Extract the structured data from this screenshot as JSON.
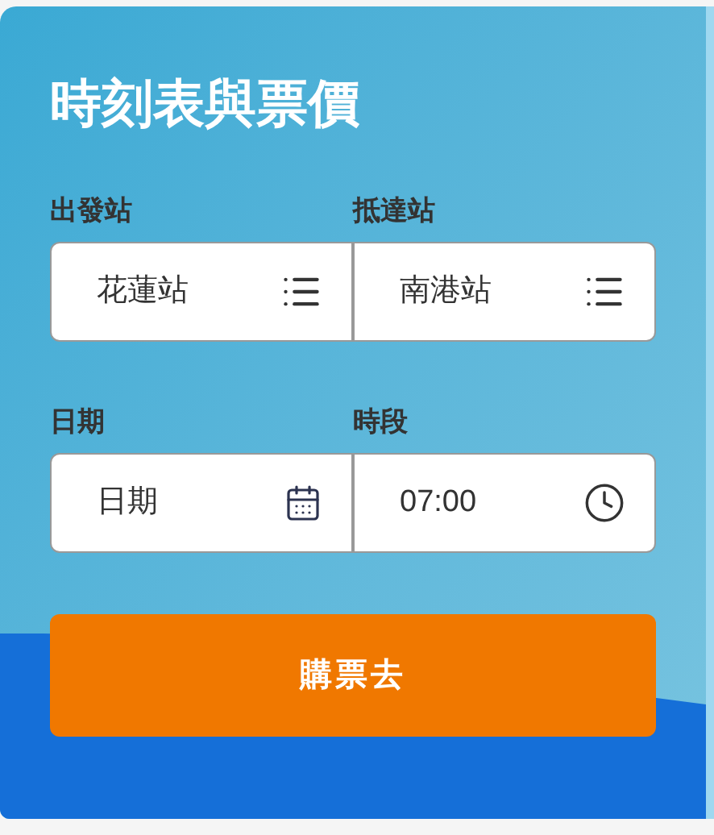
{
  "title": "時刻表與票價",
  "rows": [
    {
      "fields": [
        {
          "label": "出發站",
          "value": "花蓮站",
          "kind": "list"
        },
        {
          "label": "抵達站",
          "value": "南港站",
          "kind": "list"
        }
      ]
    },
    {
      "fields": [
        {
          "label": "日期",
          "placeholder": "日期",
          "kind": "date"
        },
        {
          "label": "時段",
          "value": "07:00",
          "kind": "time"
        }
      ]
    }
  ],
  "button": "購票去"
}
